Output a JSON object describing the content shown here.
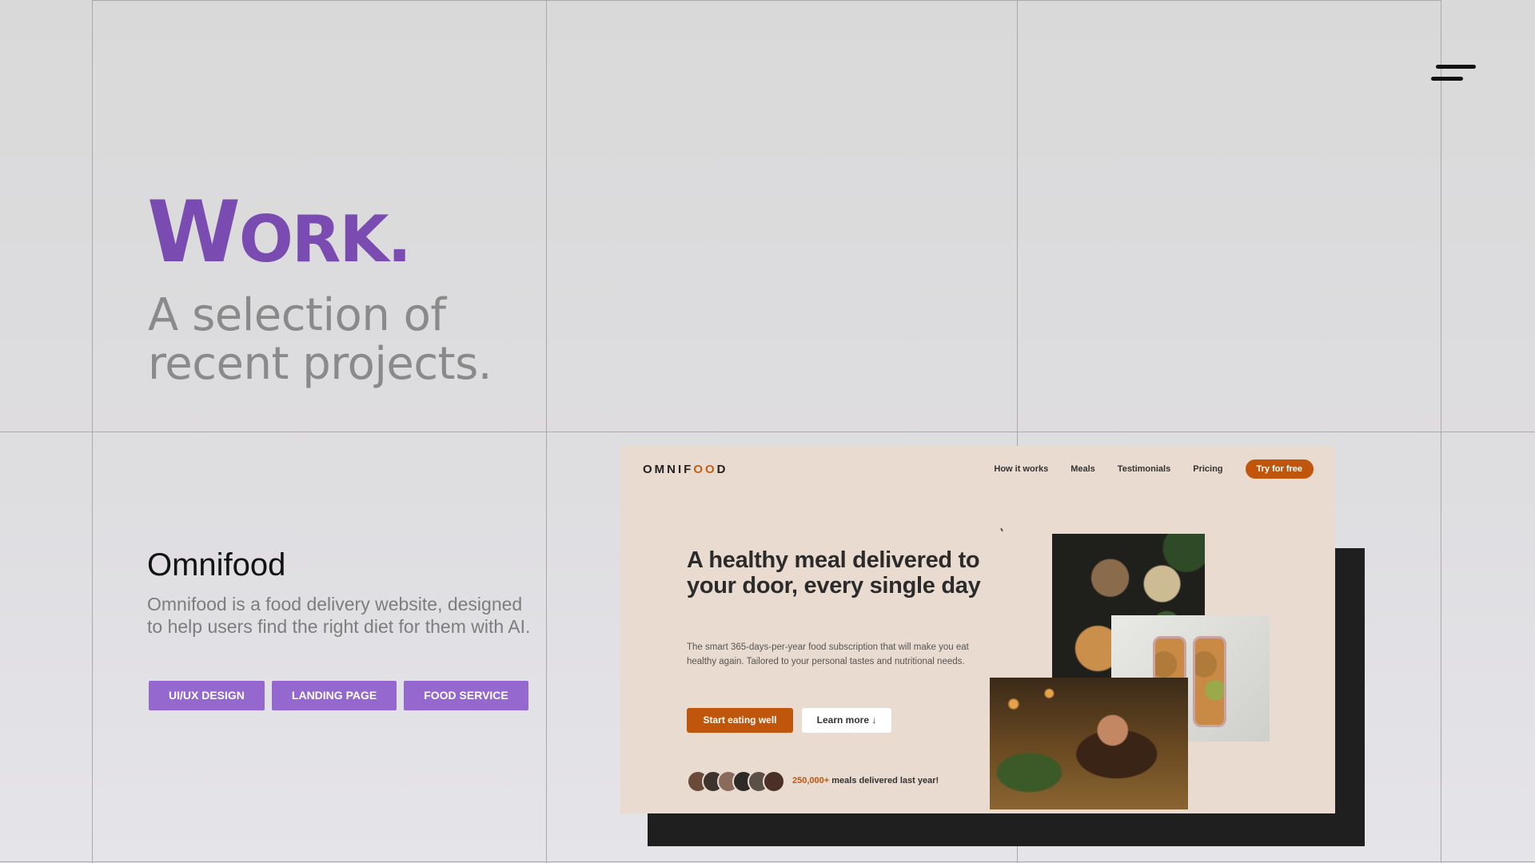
{
  "hero": {
    "work_cap": "W",
    "work_rest": "ORK.",
    "subtitle": "A selection of recent projects."
  },
  "project": {
    "title": "Omnifood",
    "description": "Omnifood is a food delivery website, designed to help users find the right diet for them with AI.",
    "tags": [
      "UI/UX DESIGN",
      "LANDING PAGE",
      "FOOD SERVICE"
    ]
  },
  "preview": {
    "logo_a": "OMNIF",
    "logo_o": "OO",
    "logo_b": "D",
    "nav": [
      "How it works",
      "Meals",
      "Testimonials",
      "Pricing"
    ],
    "nav_cta": "Try for free",
    "headline": "A healthy meal delivered to your door, every single day",
    "body": "The smart 365-days-per-year food subscription that will make you eat healthy again. Tailored to your personal tastes and nutritional needs.",
    "btn_primary": "Start eating well",
    "btn_secondary": "Learn more ↓",
    "delivered_num": "250,000+",
    "delivered_text": " meals delivered last year!"
  },
  "colors": {
    "accent_purple": "#7a4bb0",
    "tag_purple": "#9468cf",
    "omnifood_orange": "#c0560c",
    "mock_bg": "#e9dbcf"
  },
  "icons": {
    "menu": "hamburger-icon"
  }
}
